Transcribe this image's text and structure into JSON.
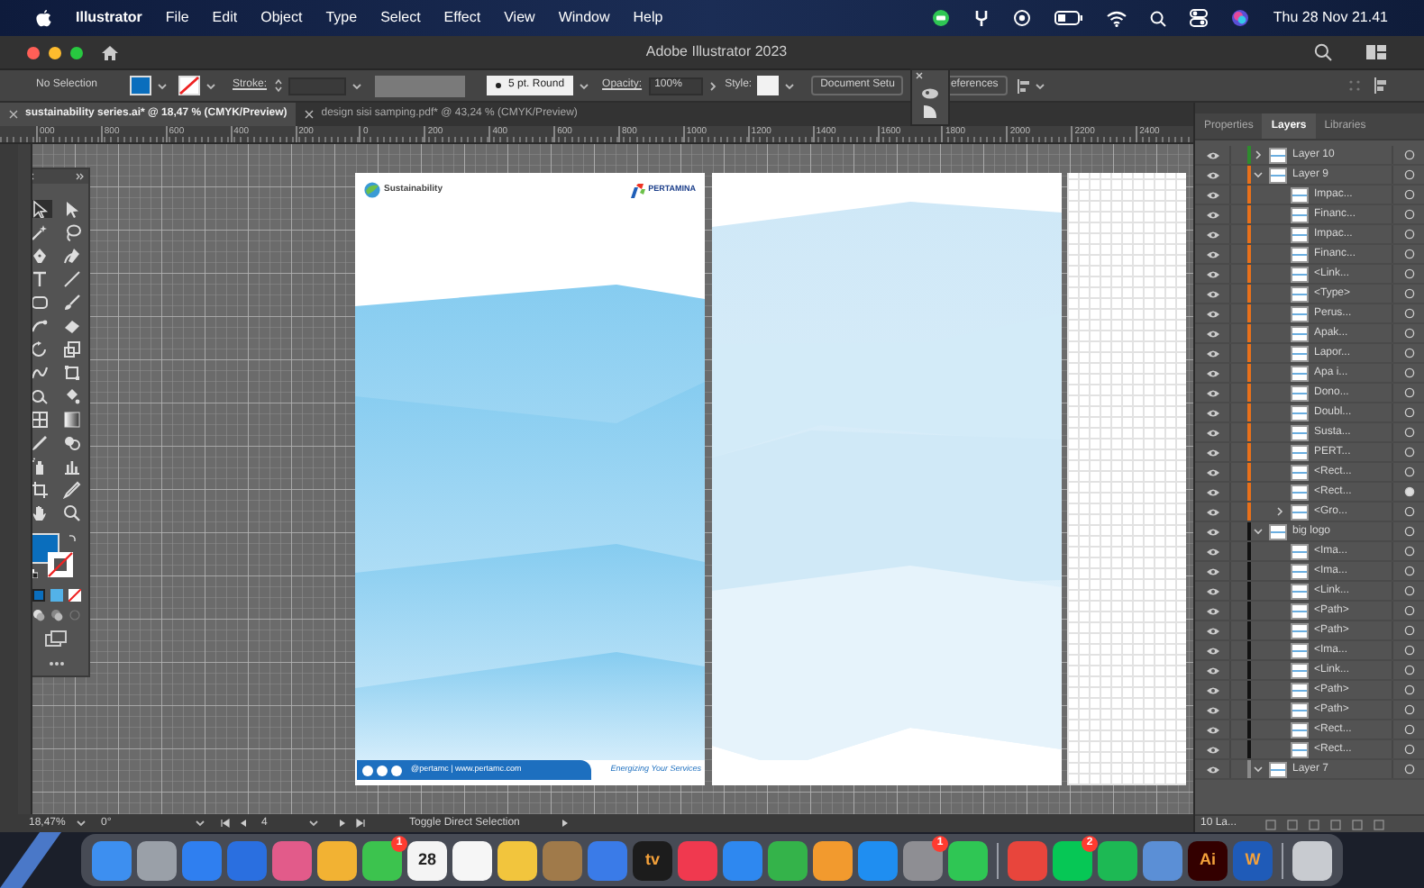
{
  "menu_bar": {
    "app": "Illustrator",
    "items": [
      "File",
      "Edit",
      "Object",
      "Type",
      "Select",
      "Effect",
      "View",
      "Window",
      "Help"
    ],
    "clock": "Thu 28 Nov 21.41"
  },
  "window": {
    "title": "Adobe Illustrator 2023"
  },
  "control_bar": {
    "selection": "No Selection",
    "stroke_label": "Stroke:",
    "brush": "5 pt. Round",
    "opacity_label": "Opacity:",
    "opacity": "100%",
    "style_label": "Style:",
    "buttons": [
      "Document Setu",
      "eferences"
    ]
  },
  "tabs": [
    {
      "label": "sustainability series.ai* @ 18,47 % (CMYK/Preview)",
      "selected": true
    },
    {
      "label": "design sisi samping.pdf* @ 43,24 % (CMYK/Preview)",
      "selected": false
    }
  ],
  "ruler": [
    "000",
    "800",
    "600",
    "400",
    "200",
    "0",
    "200",
    "400",
    "600",
    "800",
    "1000",
    "1200",
    "1400",
    "1600",
    "1800",
    "2000",
    "2200",
    "2400"
  ],
  "artboard": {
    "brand": "Sustainability",
    "logo": "PERTAMINA",
    "social": "@pertamc | www.pertamc.com",
    "tagline": "Energizing Your Services"
  },
  "panel_tabs": [
    {
      "label": "Properties",
      "selected": false
    },
    {
      "label": "Layers",
      "selected": true
    },
    {
      "label": "Libraries",
      "selected": false
    }
  ],
  "layers": [
    {
      "name": "Layer 10",
      "color": "#2e8b2e",
      "expanded": false
    },
    {
      "name": "Layer 9",
      "color": "#e8701a",
      "expanded": true,
      "children": [
        {
          "name": "Impac...",
          "targeted": false
        },
        {
          "name": "Financ...",
          "targeted": false
        },
        {
          "name": "Impac...",
          "targeted": false
        },
        {
          "name": "Financ...",
          "targeted": false
        },
        {
          "name": "<Link...",
          "targeted": false
        },
        {
          "name": "<Type>",
          "targeted": false
        },
        {
          "name": "Perus...",
          "targeted": false
        },
        {
          "name": "Apak...",
          "targeted": false
        },
        {
          "name": "Lapor...",
          "targeted": false
        },
        {
          "name": "Apa i...",
          "targeted": false
        },
        {
          "name": "Dono...",
          "targeted": false
        },
        {
          "name": "Doubl...",
          "targeted": false
        },
        {
          "name": "Susta...",
          "targeted": false
        },
        {
          "name": "PERT...",
          "targeted": false
        },
        {
          "name": "<Rect...",
          "targeted": false
        },
        {
          "name": "<Rect...",
          "targeted": true
        },
        {
          "name": "<Gro...",
          "targeted": false,
          "expanded": false
        }
      ]
    },
    {
      "name": "big logo",
      "color": "#111111",
      "expanded": true,
      "children": [
        {
          "name": "<Ima...",
          "targeted": false
        },
        {
          "name": "<Ima...",
          "targeted": false
        },
        {
          "name": "<Link...",
          "targeted": false
        },
        {
          "name": "<Path>",
          "targeted": false
        },
        {
          "name": "<Path>",
          "targeted": false
        },
        {
          "name": "<Ima...",
          "targeted": false
        },
        {
          "name": "<Link...",
          "targeted": false
        },
        {
          "name": "<Path>",
          "targeted": false
        },
        {
          "name": "<Path>",
          "targeted": false
        },
        {
          "name": "<Rect...",
          "targeted": false
        },
        {
          "name": "<Rect...",
          "targeted": false
        }
      ]
    },
    {
      "name": "Layer 7",
      "color": "#8a8a8a",
      "expanded": true
    }
  ],
  "layers_footer": "10 La...",
  "status_bar": {
    "zoom": "18,47%",
    "rotation": "0°",
    "artboard": "4",
    "tool": "Toggle Direct Selection"
  },
  "dock": [
    {
      "kind": "app",
      "color": "#3d8ff0"
    },
    {
      "kind": "app",
      "color": "#9aa0a8"
    },
    {
      "kind": "app",
      "color": "#2f7ff0"
    },
    {
      "kind": "app",
      "color": "#2a6fe0"
    },
    {
      "kind": "app",
      "color": "#e25b8a"
    },
    {
      "kind": "app",
      "color": "#f2b233"
    },
    {
      "kind": "app",
      "color": "#3cc34e",
      "badge": "1"
    },
    {
      "kind": "app",
      "color": "#f4f4f4",
      "label": "28"
    },
    {
      "kind": "app",
      "color": "#f6f6f6"
    },
    {
      "kind": "app",
      "color": "#f2c53d"
    },
    {
      "kind": "app",
      "color": "#a07a4a"
    },
    {
      "kind": "app",
      "color": "#3a7be8"
    },
    {
      "kind": "app",
      "color": "#1c1c1c",
      "label": "tv"
    },
    {
      "kind": "app",
      "color": "#f0394f"
    },
    {
      "kind": "app",
      "color": "#2e88f0"
    },
    {
      "kind": "app",
      "color": "#34b34a"
    },
    {
      "kind": "app",
      "color": "#f29a2e"
    },
    {
      "kind": "app",
      "color": "#1f8ef1"
    },
    {
      "kind": "app",
      "color": "#8e8e93",
      "badge": "1"
    },
    {
      "kind": "app",
      "color": "#2fc654"
    },
    {
      "kind": "separator"
    },
    {
      "kind": "app",
      "color": "#e8453c"
    },
    {
      "kind": "app",
      "color": "#06c755",
      "badge": "2"
    },
    {
      "kind": "app",
      "color": "#1db954"
    },
    {
      "kind": "app",
      "color": "#5b8fd6"
    },
    {
      "kind": "app",
      "color": "#330000",
      "label": "Ai"
    },
    {
      "kind": "app",
      "color": "#1f5bb8",
      "label": "W"
    },
    {
      "kind": "separator"
    },
    {
      "kind": "app",
      "color": "#c8cbd0"
    }
  ]
}
